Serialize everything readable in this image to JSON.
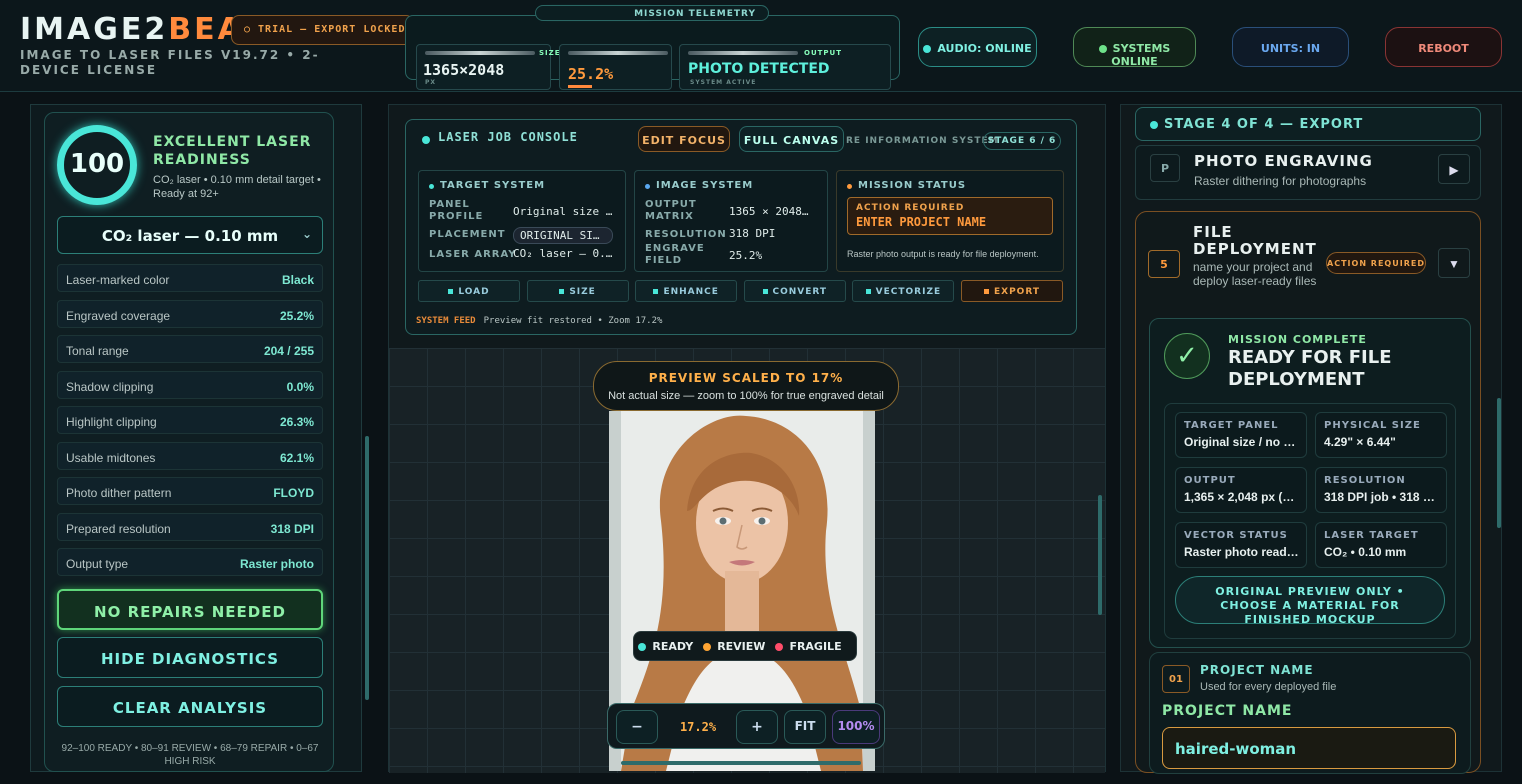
{
  "header": {
    "logo_a": "IMAGE2",
    "logo_b": "BEAM",
    "subtitle": "IMAGE TO LASER FILES V19.72 • 2-DEVICE LICENSE",
    "trial": "○ TRIAL — EXPORT LOCKED",
    "telemetry_label": "MISSION TELEMETRY",
    "size_key": "SIZE",
    "size_val": "1365×2048",
    "size_unit": "PX",
    "coverage_val": "25.2%",
    "output_key": "OUTPUT",
    "output_val": "PHOTO DETECTED",
    "output_sub": "SYSTEM ACTIVE",
    "audio": "AUDIO: ONLINE",
    "systems": "SYSTEMS ONLINE",
    "units": "UNITS: IN",
    "reboot": "REBOOT"
  },
  "left": {
    "score": "100",
    "readiness_title": "EXCELLENT LASER READINESS",
    "readiness_sub": "CO₂ laser • 0.10 mm detail target • Ready at 92+",
    "laser_select": "CO₂ laser — 0.10 mm",
    "rows": [
      {
        "label": "Laser-marked color",
        "value": "Black"
      },
      {
        "label": "Engraved coverage",
        "value": "25.2%"
      },
      {
        "label": "Tonal range",
        "value": "204 / 255"
      },
      {
        "label": "Shadow clipping",
        "value": "0.0%"
      },
      {
        "label": "Highlight clipping",
        "value": "26.3%"
      },
      {
        "label": "Usable midtones",
        "value": "62.1%"
      },
      {
        "label": "Photo dither pattern",
        "value": "FLOYD"
      },
      {
        "label": "Prepared resolution",
        "value": "318 DPI"
      },
      {
        "label": "Output type",
        "value": "Raster photo"
      }
    ],
    "no_repairs": "NO REPAIRS NEEDED",
    "hide_diag": "HIDE DIAGNOSTICS",
    "clear": "CLEAR ANALYSIS",
    "legend": "92–100 READY • 80–91 REVIEW • 68–79 REPAIR • 0–67 HIGH RISK"
  },
  "console": {
    "title": "LASER JOB CONSOLE",
    "edit_focus": "EDIT FOCUS",
    "full_canvas": "FULL CANVAS",
    "info_system": "RE INFORMATION SYSTEM",
    "stage": "STAGE 6 / 6",
    "target": {
      "title": "TARGET SYSTEM",
      "k1": "PANEL PROFILE",
      "v1": "Original size …",
      "k2": "PLACEMENT",
      "v2": "ORIGINAL SI…",
      "k3": "LASER ARRAY",
      "v3": "CO₂ laser — 0.…"
    },
    "image": {
      "title": "IMAGE SYSTEM",
      "k1": "OUTPUT MATRIX",
      "v1": "1365 × 2048…",
      "k2": "RESOLUTION",
      "v2": "318 DPI",
      "k3": "ENGRAVE FIELD",
      "v3": "25.2%"
    },
    "mission": {
      "title": "MISSION STATUS",
      "action": "ACTION REQUIRED",
      "enter": "ENTER PROJECT NAME",
      "note": "Raster photo output is ready for file deployment."
    },
    "pipeline": [
      "LOAD",
      "SIZE",
      "ENHANCE",
      "CONVERT",
      "VECTORIZE",
      "EXPORT"
    ],
    "feed_label": "SYSTEM FEED",
    "feed_text": "Preview fit restored • Zoom 17.2%"
  },
  "preview": {
    "banner_title": "PREVIEW SCALED TO 17%",
    "banner_sub": "Not actual size — zoom to 100% for true engraved detail",
    "chips": [
      "READY",
      "REVIEW",
      "FRAGILE"
    ],
    "chip_colors": [
      "#49e6d8",
      "#ffa533",
      "#ff4d6a"
    ],
    "zoom_out": "−",
    "zoom_val": "17.2%",
    "zoom_in": "+",
    "fit": "FIT",
    "hundred": "100%"
  },
  "right": {
    "stage": "STAGE 4 OF 4 — EXPORT",
    "pe_badge": "P",
    "pe_title": "PHOTO ENGRAVING",
    "pe_sub": "Raster dithering for photographs",
    "fd_num": "5",
    "fd_title": "FILE DEPLOYMENT",
    "fd_sub": "name your project and deploy laser-ready files",
    "fd_badge": "ACTION REQUIRED",
    "mc_label": "MISSION COMPLETE",
    "mc_title": "READY FOR FILE DEPLOYMENT",
    "grid": [
      {
        "k": "TARGET PANEL",
        "v": "Original size / no …"
      },
      {
        "k": "PHYSICAL SIZE",
        "v": "4.29\" × 6.44\""
      },
      {
        "k": "OUTPUT",
        "v": "1,365 × 2,048 px (…"
      },
      {
        "k": "RESOLUTION",
        "v": "318 DPI job • 318 …"
      },
      {
        "k": "VECTOR STATUS",
        "v": "Raster photo read…"
      },
      {
        "k": "LASER TARGET",
        "v": "CO₂ • 0.10 mm"
      }
    ],
    "preview_only": "ORIGINAL PREVIEW ONLY • CHOOSE A MATERIAL FOR FINISHED MOCKUP",
    "pn_num": "01",
    "pn_title": "PROJECT NAME",
    "pn_sub": "Used for every deployed file",
    "pn_label": "PROJECT NAME",
    "pn_value": "haired-woman"
  }
}
